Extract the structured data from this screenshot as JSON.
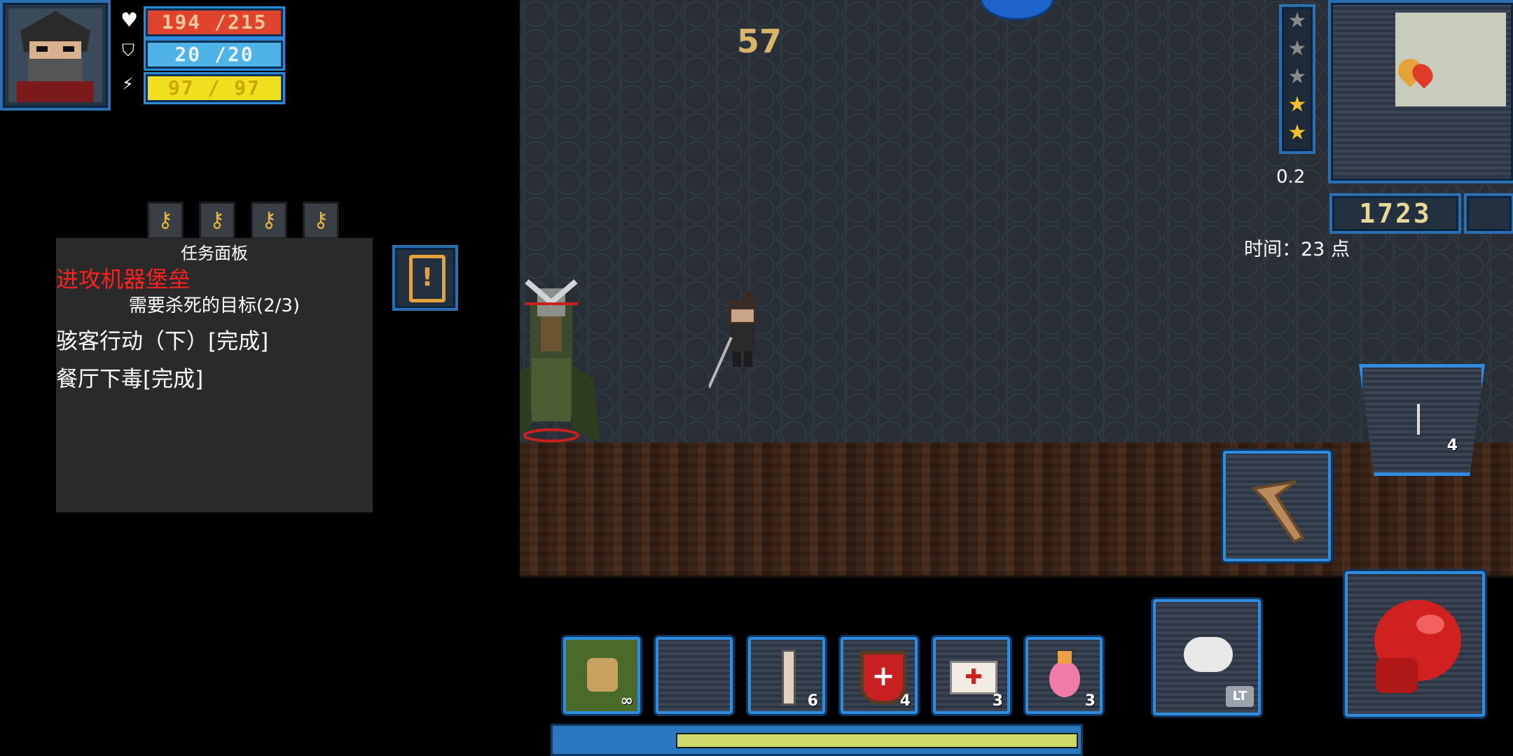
{
  "player": {
    "hp": "194 /215",
    "shield": "20 /20",
    "energy": "97 / 97",
    "portrait": "ninja-portrait"
  },
  "keys": [
    "key-icon",
    "key-icon",
    "key-icon",
    "key-icon"
  ],
  "quest_panel": {
    "title": "任务面板",
    "mission": "进攻机器堡垒",
    "objective": "需要杀死的目标(2/3)",
    "items": [
      "骇客行动（下）[完成]",
      "餐厅下毒[完成]"
    ]
  },
  "hud": {
    "combo": "57",
    "multiplier": "0.2",
    "gold": "1723",
    "time": "时间：23 点"
  },
  "stars": {
    "filled": 2,
    "total": 5
  },
  "weapon_slot": {
    "count": "4"
  },
  "hotbar": [
    {
      "icon": "backpack-icon",
      "count": "∞"
    },
    {
      "icon": "empty",
      "count": ""
    },
    {
      "icon": "syringe-icon",
      "count": "6"
    },
    {
      "icon": "armor-medkit-icon",
      "count": "4"
    },
    {
      "icon": "medkit-icon",
      "count": "3"
    },
    {
      "icon": "potion-icon",
      "count": "3"
    }
  ],
  "skill_badge": "LT",
  "colors": {
    "hp": "#e0442c",
    "shield": "#4fb3e8",
    "energy": "#f0e020",
    "mission": "#ff2020",
    "combo": "#d9b56a",
    "bar_fill": "#cfd96a"
  }
}
